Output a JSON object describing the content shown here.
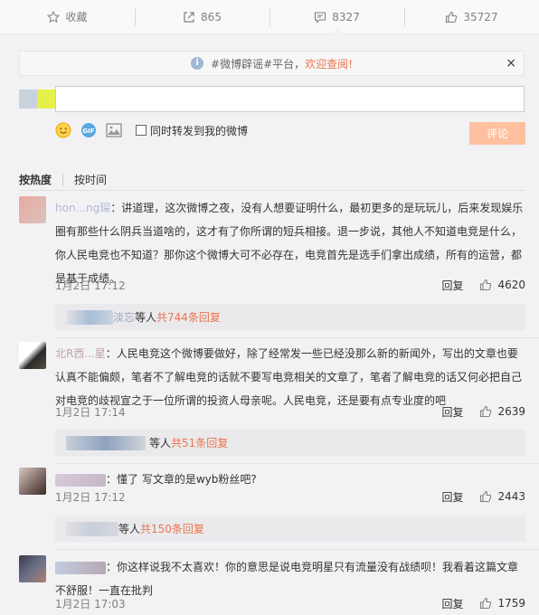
{
  "action_bar": {
    "favorite": "收藏",
    "forward": "865",
    "comment": "8327",
    "like": "35727"
  },
  "notice": {
    "text": "#微博辟谣#平台，",
    "link": "欢迎查阅!",
    "close": "×"
  },
  "composer": {
    "input_value": "",
    "forward_label": "同时转发到我的微博",
    "submit_label": "评论"
  },
  "sort": {
    "hot": "按热度",
    "time": "按时间"
  },
  "comments": [
    {
      "name": "hon...ng琛",
      "text": "讲道理，这次微博之夜，没有人想要证明什么，最初更多的是玩玩儿，后来发现娱乐圈有那些什么阴兵当道啥的，这才有了你所谓的短兵相接。退一步说，其他人不知道电竞是什么，你人民电竞也不知道？那你这个微博大可不必存在，电竞首先是选手们拿出成绩，所有的运营，都是基于成绩。",
      "time": "1月2日 17:12",
      "reply": "回复",
      "likes": "4620",
      "sub_name": "淡忘",
      "sub_mid": " 等人 ",
      "sub_count": "共744条回复"
    },
    {
      "name": "北R西...星",
      "text": "人民电竞这个微博要做好，除了经常发一些已经没那么新的新闻外，写出的文章也要认真不能偏颇，笔者不了解电竞的话就不要写电竞相关的文章了，笔者了解电竞的话又何必把自己对电竞的歧视宣之于一位所谓的投资人母亲呢。人民电竞，还是要有点专业度的吧",
      "time": "1月2日 17:14",
      "reply": "回复",
      "likes": "2639",
      "sub_name": "",
      "sub_mid": "等人 ",
      "sub_count": "共51条回复"
    },
    {
      "name": "",
      "text": "懂了 写文章的是wyb粉丝吧?",
      "time": "1月2日 17:12",
      "reply": "回复",
      "likes": "2443",
      "sub_name": "",
      "sub_mid": " 等人 ",
      "sub_count": "共150条回复"
    },
    {
      "name": "",
      "text": "你这样说我不太喜欢！你的意思是说电竞明星只有流量没有战绩呗！我看着这篇文章不舒服！一直在批判",
      "time": "1月2日 17:03",
      "reply": "回复",
      "likes": "1759"
    }
  ]
}
